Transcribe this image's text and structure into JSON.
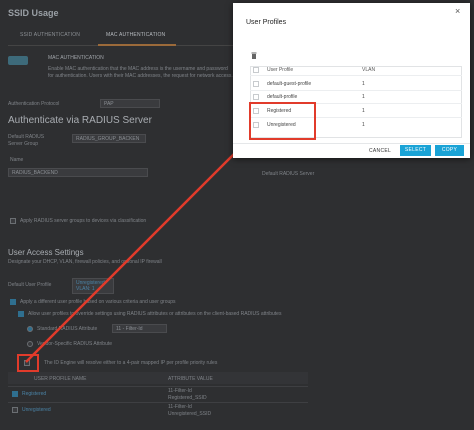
{
  "background": {
    "page_title": "SSID Usage",
    "tabs": [
      "SSID AUTHENTICATION",
      "MAC AUTHENTICATION"
    ],
    "mac_auth_label": "MAC AUTHENTICATION",
    "mac_auth_desc": "Enable MAC authentication that the MAC address is the username and password for authentication. Users with their MAC addresses, the request for network access.",
    "auth_protocol_label": "Authentication Protocol",
    "auth_protocol_value": "PAP",
    "radius_heading": "Authenticate via RADIUS Server",
    "default_radius_label": "Default RADIUS Server Group",
    "default_radius_value": "RADIUS_GROUP_BACKEN",
    "col_name": "Name",
    "col_default": "Default RADIUS Server",
    "radius_row_name": "RADIUS_BACKEND",
    "apply_radius_text": "Apply RADIUS server groups to devices via classification",
    "ual_heading": "User Access Settings",
    "ual_desc": "Designate your DHCP, VLAN, firewall policies, and optional IP firewall",
    "default_user_profile_label": "Default User Profile",
    "default_user_profile_value": "Unregistered VLAN: 1",
    "apply_diff_text": "Apply a different user profile based on various criteria and user groups",
    "allow_override_text": "Allow user profiles to override settings using RADIUS attributes or attributes on the client-based RADIUS attributes",
    "standard_attr_label": "Standard RADIUS Attribute",
    "standard_attr_value": "11 - Filter-Id",
    "vendor_attr_label": "Vendor-Specific RADIUS Attribute",
    "map_text": "The ID Engine will resolve either to a 4-pair mapped IP per profile priority rules",
    "table_cols": [
      "USER PROFILE NAME",
      "ATTRIBUTE VALUE"
    ],
    "rows": [
      {
        "name": "Registered",
        "value": "11-Filter-Id Registered_SSID"
      },
      {
        "name": "Unregistered",
        "value": "11-Filter-Id Unregistered_SSID"
      }
    ]
  },
  "modal": {
    "title": "User Profiles",
    "close_glyph": "×",
    "columns": {
      "profile": "User Profile",
      "vlan": "VLAN"
    },
    "profiles": [
      {
        "name": "default-guest-profile",
        "vlan": "1"
      },
      {
        "name": "default-profile",
        "vlan": "1"
      },
      {
        "name": "Registered",
        "vlan": "1"
      },
      {
        "name": "Unregistered",
        "vlan": "1"
      }
    ],
    "cancel_label": "CANCEL",
    "select_label": "SELECT",
    "copy_label": "COPY",
    "accent_color": "#1aa3d6",
    "highlight_color": "#e13b2b"
  }
}
